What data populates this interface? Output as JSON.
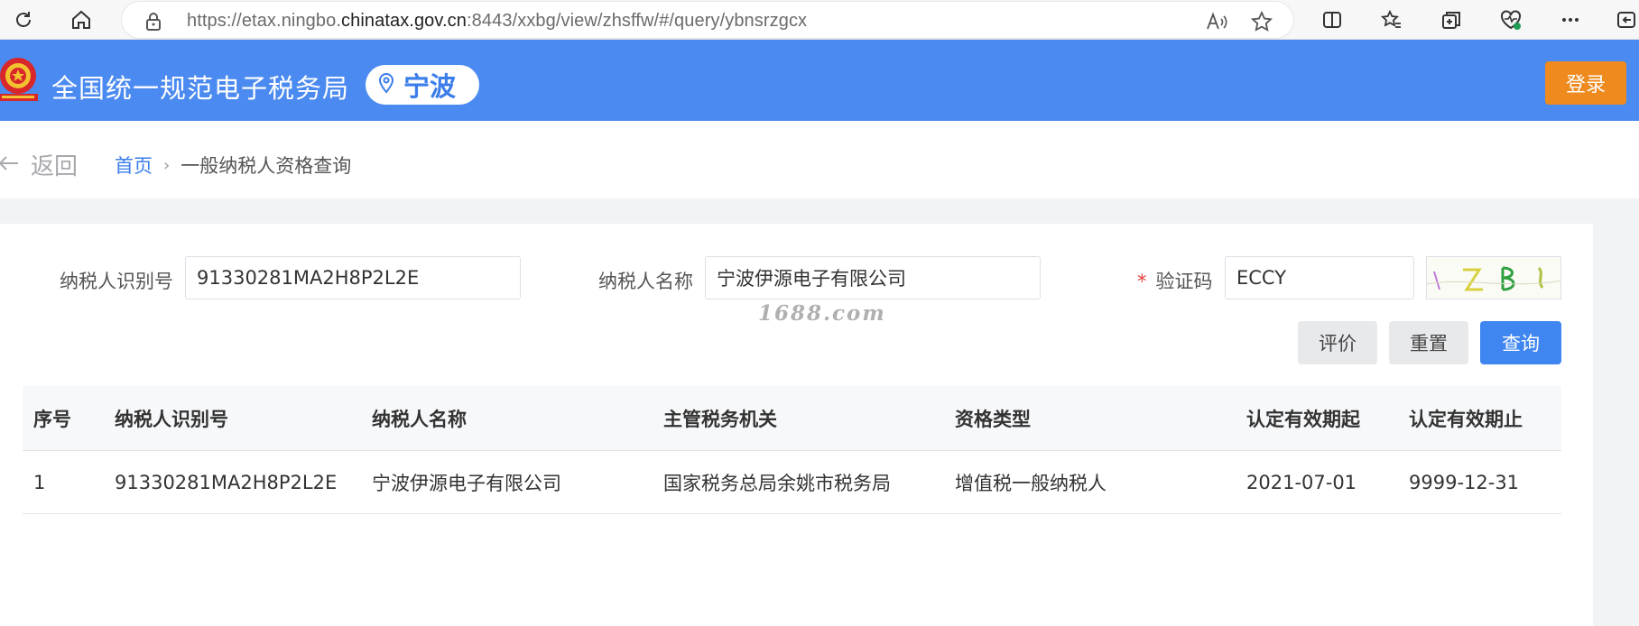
{
  "browser": {
    "url_prefix": "https://etax.ningbo.",
    "url_host": "chinatax.gov.cn",
    "url_suffix": ":8443/xxbg/view/zhsffw/#/query/ybnsrzgcx"
  },
  "header": {
    "site_title": "全国统一规范电子税务局",
    "city": "宁波",
    "login_label": "登录",
    "accent_color": "#4b8af0"
  },
  "breadcrumb": {
    "back_label": "返回",
    "home": "首页",
    "current": "一般纳税人资格查询"
  },
  "form": {
    "taxpayer_id_label": "纳税人识别号",
    "taxpayer_id_value": "91330281MA2H8P2L2E",
    "taxpayer_name_label": "纳税人名称",
    "taxpayer_name_value": "宁波伊源电子有限公司",
    "captcha_required_mark": "*",
    "captcha_label": "验证码",
    "captcha_value": "ECCY",
    "watermark": "1688.com",
    "buttons": {
      "evaluate": "评价",
      "reset": "重置",
      "query": "查询"
    }
  },
  "table": {
    "columns": [
      "序号",
      "纳税人识别号",
      "纳税人名称",
      "主管税务机关",
      "资格类型",
      "认定有效期起",
      "认定有效期止"
    ],
    "rows": [
      [
        "1",
        "91330281MA2H8P2L2E",
        "宁波伊源电子有限公司",
        "国家税务总局余姚市税务局",
        "增值税一般纳税人",
        "2021-07-01",
        "9999-12-31"
      ]
    ]
  }
}
